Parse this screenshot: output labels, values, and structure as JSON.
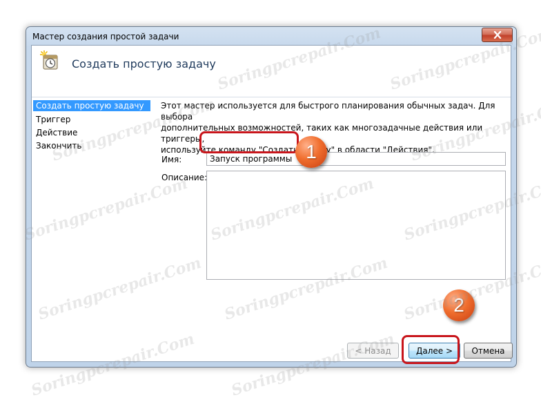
{
  "window": {
    "title": "Мастер создания простой задачи"
  },
  "header": {
    "title": "Создать простую задачу"
  },
  "sidebar": {
    "items": [
      {
        "label": "Создать простую задачу",
        "selected": true
      },
      {
        "label": "Триггер"
      },
      {
        "label": "Действие"
      },
      {
        "label": "Закончить"
      }
    ]
  },
  "content": {
    "description_lines": [
      "Этот мастер используется для быстрого планирования обычных задач.  Для выбора",
      "дополнительных возможностей, таких как многозадачные действия или триггеры,",
      "используйте команду \"Создать задачу\" в области \"Действия\"."
    ],
    "name_label": "Имя:",
    "name_value": "Запуск программы",
    "description_label": "Описание:",
    "description_value": ""
  },
  "buttons": {
    "back": "< Назад",
    "next": "Далее >",
    "cancel": "Отмена"
  },
  "callouts": {
    "one": "1",
    "two": "2"
  },
  "watermark": {
    "text": "Soringpcrepair.Com"
  },
  "colors": {
    "selection": "#3399ff",
    "callout": "#c8151b",
    "badge": "#f06e2e",
    "header_title": "#1e395b"
  }
}
